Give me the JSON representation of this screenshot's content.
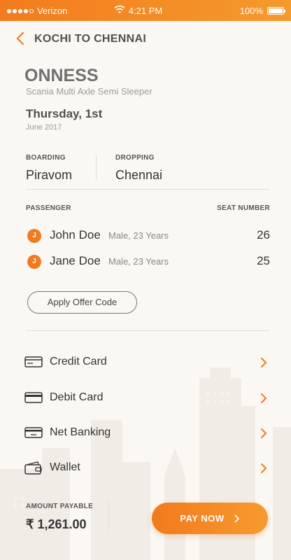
{
  "status_bar": {
    "carrier": "Verizon",
    "time": "4:21 PM",
    "battery": "100%",
    "battery_level": 1.0
  },
  "header": {
    "title": "KOCHI TO CHENNAI"
  },
  "trip": {
    "operator": "ONNESS",
    "bus_type": "Scania Multi Axle Semi Sleeper",
    "date_main": "Thursday, 1st",
    "date_sub": "June 2017"
  },
  "points": {
    "boarding_label": "BOARDING",
    "boarding_value": "Piravom",
    "dropping_label": "DROPPING",
    "dropping_value": "Chennai"
  },
  "passengers": {
    "header_label": "PASSENGER",
    "seat_label": "SEAT NUMBER",
    "list": [
      {
        "initial": "J",
        "name": "John Doe",
        "detail": "Male, 23 Years",
        "seat": "26"
      },
      {
        "initial": "J",
        "name": "Jane Doe",
        "detail": "Male, 23 Years",
        "seat": "25"
      }
    ]
  },
  "offer": {
    "button_label": "Apply Offer Code"
  },
  "payment_methods": [
    {
      "label": "Credit Card",
      "icon": "credit-card-icon"
    },
    {
      "label": "Debit Card",
      "icon": "debit-card-icon"
    },
    {
      "label": "Net Banking",
      "icon": "net-banking-icon"
    },
    {
      "label": "Wallet",
      "icon": "wallet-icon"
    }
  ],
  "footer": {
    "amount_label": "AMOUNT PAYABLE",
    "amount_value": "₹ 1,261.00",
    "pay_button": "PAY NOW"
  },
  "colors": {
    "accent": "#f27a1c",
    "background": "#fbf8f4"
  }
}
